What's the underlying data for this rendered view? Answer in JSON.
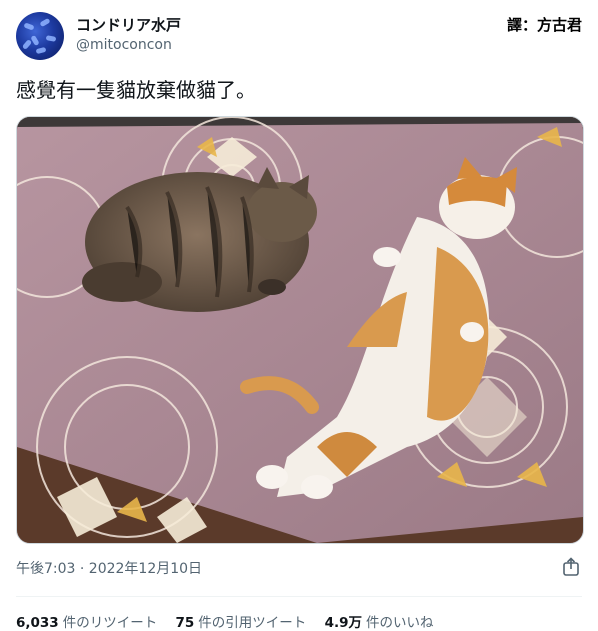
{
  "tweet": {
    "author_name": "コンドリア水戸",
    "author_handle": "@mitoconcon",
    "watermark": "譯：方古君",
    "text": "感覺有一隻貓放棄做貓了。",
    "timestamp": "午後7:03 · 2022年12月10日",
    "photo_alt": "Two cats on a pink mandala-patterned blanket"
  },
  "stats": [
    {
      "count": "6,033",
      "label": "件のリツイート"
    },
    {
      "count": "75",
      "label": "件の引用ツイート"
    },
    {
      "count": "4.9万",
      "label": "件のいいね"
    }
  ],
  "colors": {
    "blanket": "#a88a96",
    "pattern": "#f7ecd8",
    "accent": "#e8b64a",
    "floor": "#5b3a2a"
  }
}
